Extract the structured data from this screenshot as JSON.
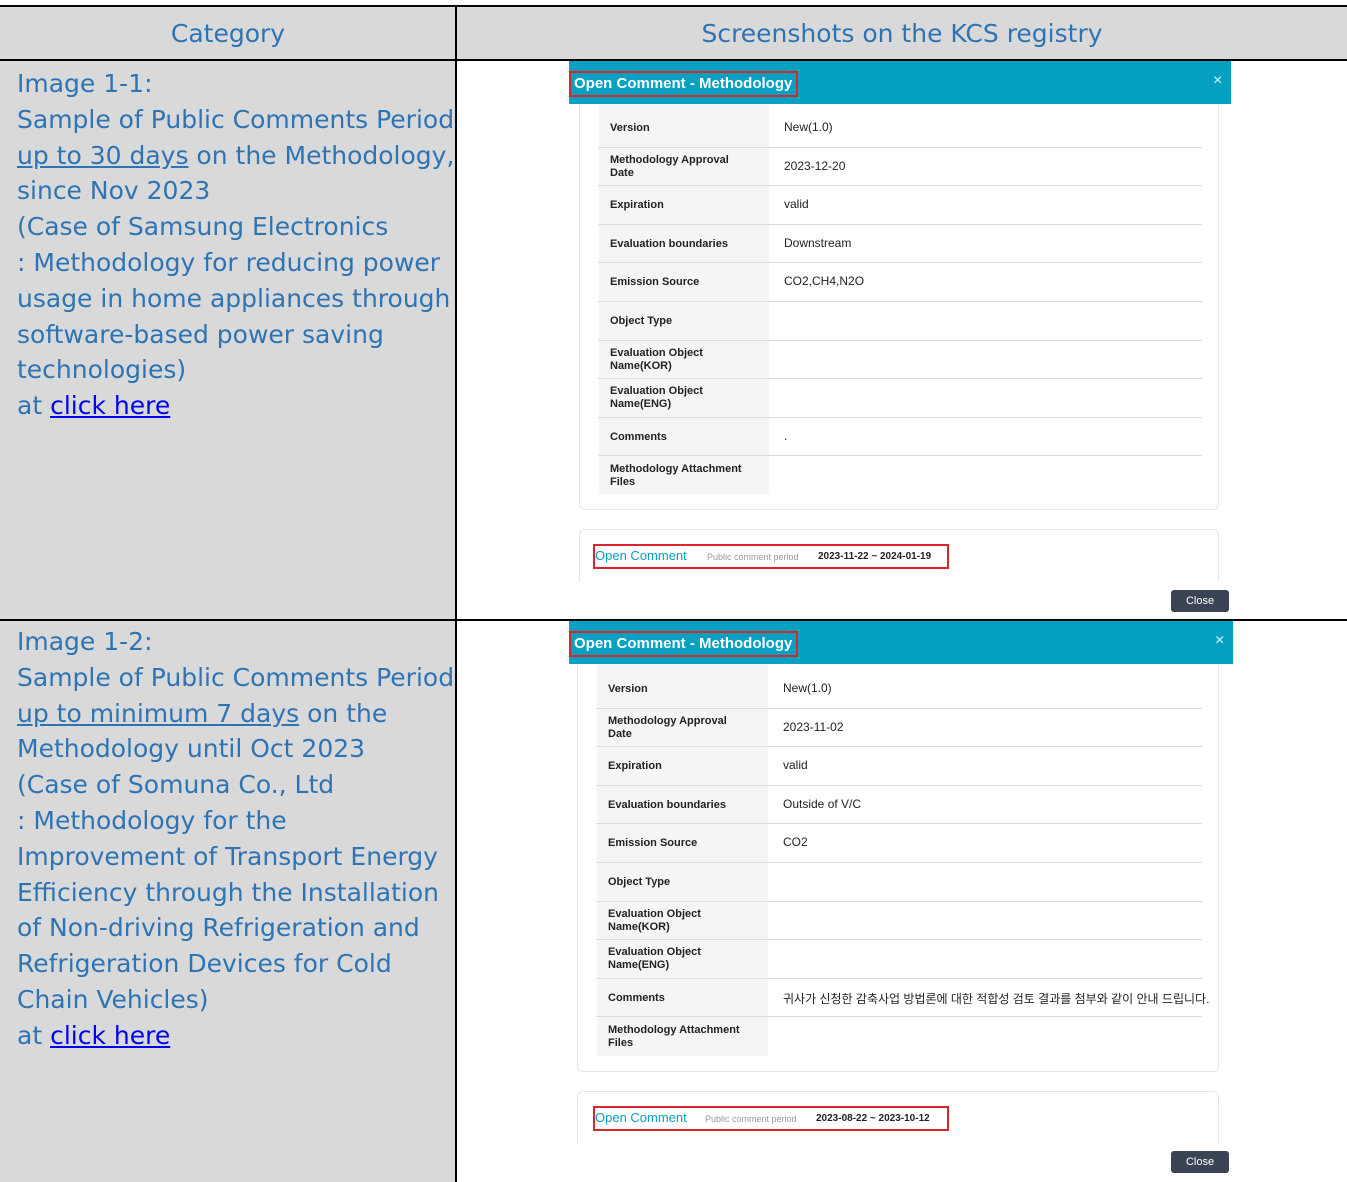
{
  "header": {
    "category": "Category",
    "screenshots": "Screenshots on the KCS registry"
  },
  "rows": [
    {
      "lines": [
        "Image 1-1:",
        "Sample of Public Comments Period",
        "up to 30 days",
        " on the Methodology,",
        "since Nov 2023",
        "(Case of Samsung Electronics",
        ": Methodology for reducing power",
        "usage in home appliances through",
        "software-based power saving",
        "technologies)",
        "at ",
        "click here"
      ],
      "dialog": {
        "title": "Open Comment - Methodology",
        "close_x": "×",
        "fields": [
          {
            "label": "Version",
            "value": "New(1.0)"
          },
          {
            "label": "Methodology Approval Date",
            "value": "2023-12-20"
          },
          {
            "label": "Expiration",
            "value": "valid"
          },
          {
            "label": "Evaluation boundaries",
            "value": "Downstream"
          },
          {
            "label": "Emission Source",
            "value": "CO2,CH4,N2O"
          },
          {
            "label": "Object Type",
            "value": ""
          },
          {
            "label": "Evaluation Object Name(KOR)",
            "value": ""
          },
          {
            "label": "Evaluation Object Name(ENG)",
            "value": ""
          },
          {
            "label": "Comments",
            "value": "."
          },
          {
            "label": "Methodology Attachment Files",
            "value": ""
          }
        ],
        "open_comment": "Open Comment",
        "period_label": "Public comment period",
        "period": "2023-11-22 ~ 2024-01-19",
        "close_button": "Close"
      }
    },
    {
      "lines": [
        "Image 1-2:",
        "Sample of Public Comments Period",
        "up to minimum 7 days",
        " on the",
        "Methodology until Oct 2023",
        "(Case of Somuna Co., Ltd",
        ": Methodology for the",
        "Improvement of Transport Energy",
        "Efficiency through the Installation",
        "of Non-driving Refrigeration and",
        "Refrigeration Devices for Cold",
        "Chain Vehicles)",
        "at ",
        "click here"
      ],
      "dialog": {
        "title": "Open Comment - Methodology",
        "close_x": "×",
        "fields": [
          {
            "label": "Version",
            "value": "New(1.0)"
          },
          {
            "label": "Methodology Approval Date",
            "value": "2023-11-02"
          },
          {
            "label": "Expiration",
            "value": "valid"
          },
          {
            "label": "Evaluation boundaries",
            "value": "Outside of V/C"
          },
          {
            "label": "Emission Source",
            "value": "CO2"
          },
          {
            "label": "Object Type",
            "value": ""
          },
          {
            "label": "Evaluation Object Name(KOR)",
            "value": ""
          },
          {
            "label": "Evaluation Object Name(ENG)",
            "value": ""
          },
          {
            "label": "Comments",
            "value": "귀사가 신청한 감축사업 방법론에 대한 적합성 검토 결과를 첨부와 같이 안내 드립니다."
          },
          {
            "label": "Methodology Attachment Files",
            "value": ""
          }
        ],
        "open_comment": "Open Comment",
        "period_label": "Public comment period",
        "period": "2023-08-22 ~ 2023-10-12",
        "close_button": "Close"
      }
    }
  ]
}
